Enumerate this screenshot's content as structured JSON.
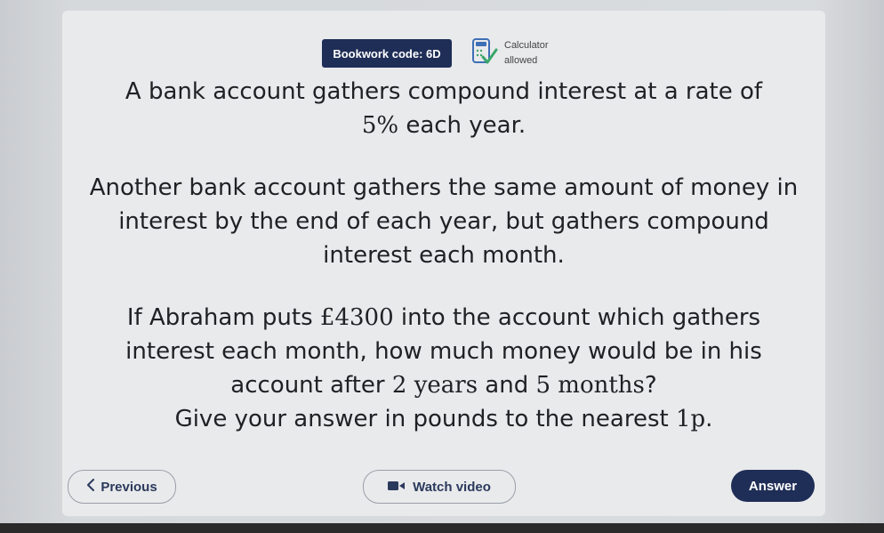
{
  "header": {
    "bookwork_label": "Bookwork code: 6D",
    "calculator_line1": "Calculator",
    "calculator_line2": "allowed"
  },
  "question": {
    "p1_a": "A bank account gathers compound interest at a rate of",
    "p1_b_num": "5%",
    "p1_b_text": " each year.",
    "p2": "Another bank account gathers the same amount of money in interest by the end of each year, but gathers compound interest each month.",
    "p3_a": "If Abraham puts ",
    "p3_amount": "£4300",
    "p3_b": " into the account which gathers interest each month, how much money would be in his account after ",
    "p3_years": "2 years",
    "p3_and": " and ",
    "p3_months": "5 months",
    "p3_q": "?",
    "p4_a": "Give your answer in pounds to the nearest ",
    "p4_unit": "1p",
    "p4_end": "."
  },
  "buttons": {
    "previous": "Previous",
    "watch_video": "Watch video",
    "answer": "Answer"
  },
  "icons": {
    "calculator": "calculator-check-icon",
    "previous": "chevron-left-icon",
    "video": "video-camera-icon"
  },
  "colors": {
    "navy": "#1f2e57",
    "calc_green": "#3aa66b",
    "calc_blue": "#3d6fb6"
  }
}
